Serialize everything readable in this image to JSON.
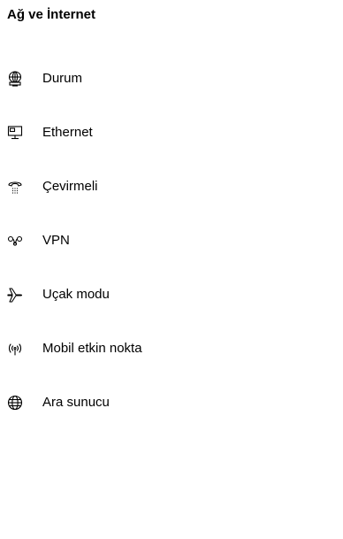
{
  "header": {
    "title": "Ağ ve İnternet"
  },
  "nav": {
    "items": [
      {
        "label": "Durum",
        "icon": "globe-monitor-icon"
      },
      {
        "label": "Ethernet",
        "icon": "ethernet-icon"
      },
      {
        "label": "Çevirmeli",
        "icon": "dial-up-phone-icon"
      },
      {
        "label": "VPN",
        "icon": "vpn-icon"
      },
      {
        "label": "Uçak modu",
        "icon": "airplane-icon"
      },
      {
        "label": "Mobil etkin nokta",
        "icon": "mobile-hotspot-icon"
      },
      {
        "label": "Ara sunucu",
        "icon": "globe-icon"
      }
    ]
  },
  "colors": {
    "background": "#ffffff",
    "text": "#000000"
  }
}
